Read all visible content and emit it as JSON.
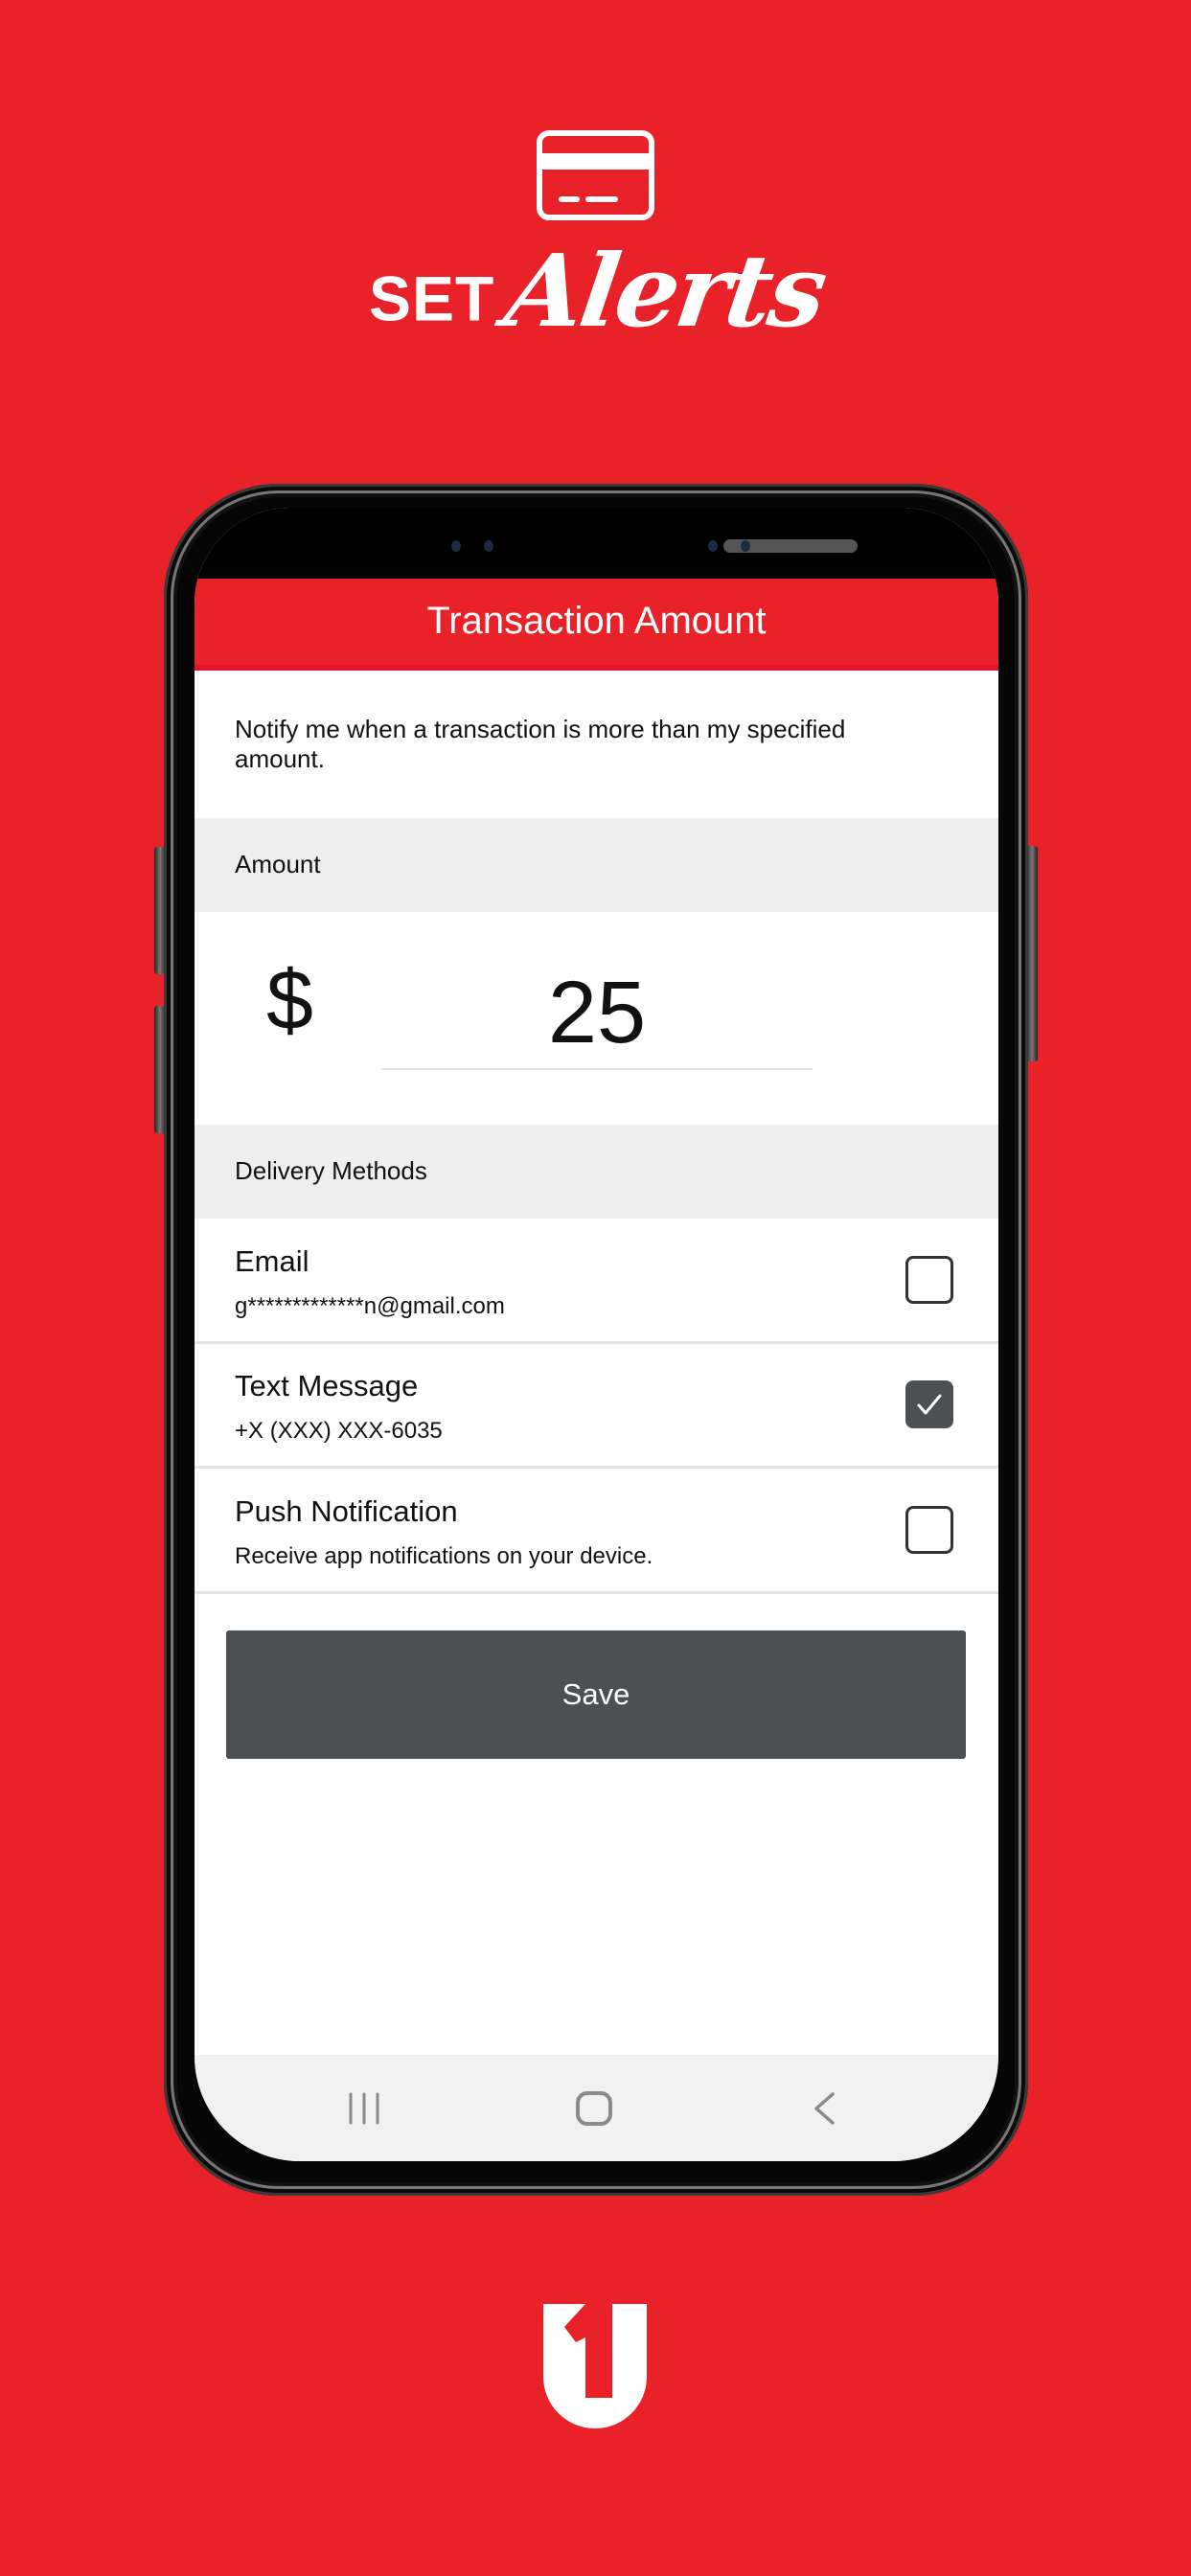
{
  "promo": {
    "title_prefix": "SET",
    "title_script": "Alerts",
    "icon": "credit-card-icon",
    "background_color": "#e92128"
  },
  "screen": {
    "header_title": "Transaction Amount",
    "description": "Notify me when a transaction is more than my specified amount.",
    "amount_section": {
      "label": "Amount",
      "currency_symbol": "$",
      "value": "25"
    },
    "delivery_section": {
      "label": "Delivery Methods",
      "methods": [
        {
          "title": "Email",
          "detail": "g*************n@gmail.com",
          "checked": false
        },
        {
          "title": "Text Message",
          "detail": "+X (XXX) XXX-6035",
          "checked": true
        },
        {
          "title": "Push Notification",
          "detail": "Receive app notifications on your device.",
          "checked": false
        }
      ]
    },
    "save_label": "Save",
    "nav_bar": {
      "recents": "recent-apps-icon",
      "home": "home-icon",
      "back": "back-icon"
    },
    "colors": {
      "header": "#e92128",
      "button": "#4c5052",
      "section_bg": "#eeeeee"
    }
  },
  "brand": {
    "logo": "brand-u1-logo"
  }
}
